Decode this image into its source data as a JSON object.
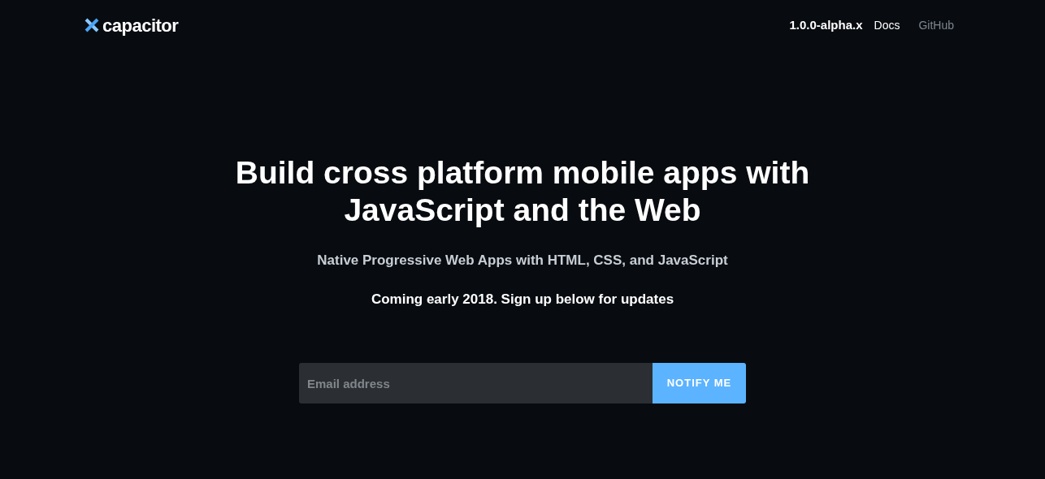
{
  "header": {
    "logo": "capacitor",
    "version": "1.0.0-alpha.x",
    "nav": [
      {
        "label": "Docs",
        "selected": true
      },
      {
        "label": "GitHub",
        "selected": false
      }
    ]
  },
  "hero": {
    "title": "Build cross platform mobile apps with JavaScript and the Web",
    "subtitle": "Native Progressive Web Apps with HTML, CSS, and JavaScript",
    "note": "Coming early 2018. Sign up below for updates"
  },
  "signup": {
    "placeholder": "Email address",
    "button": "NOTIFY ME"
  }
}
